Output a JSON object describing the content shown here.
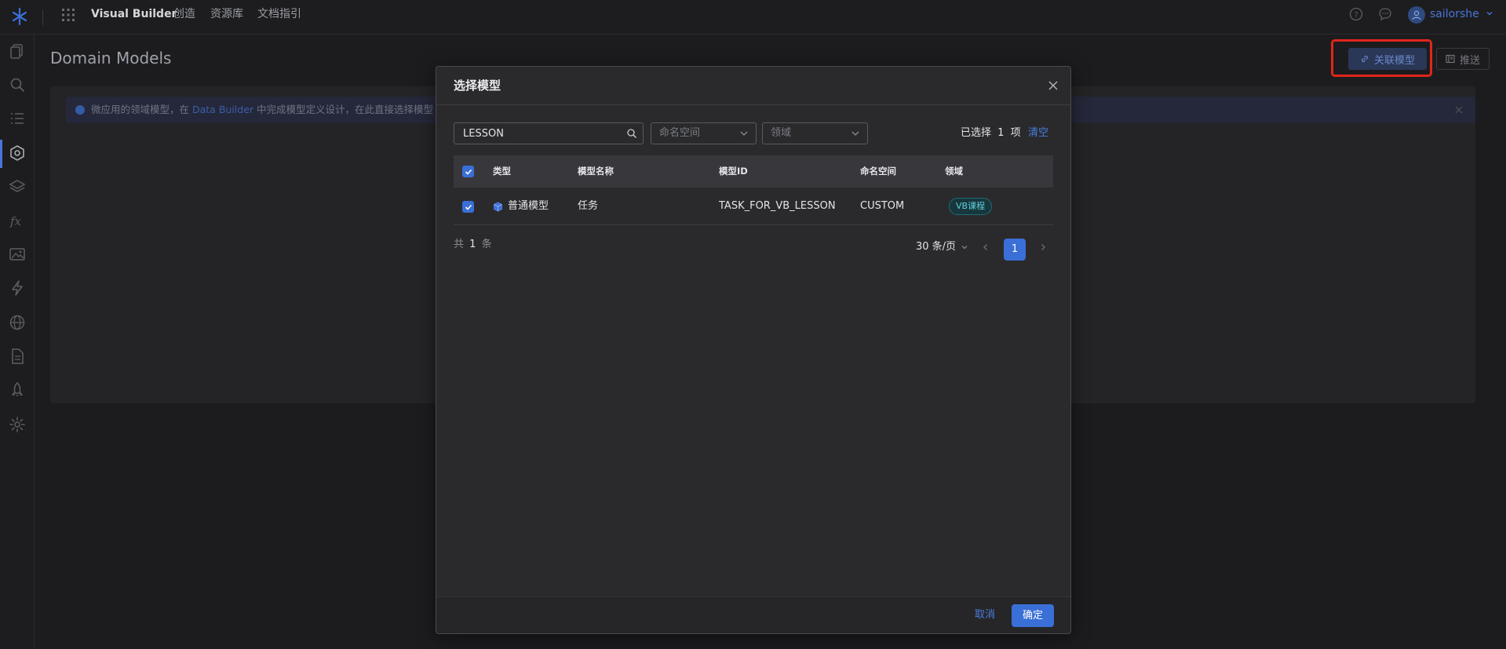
{
  "topbar": {
    "brand": "Visual Builder",
    "nav_items": [
      "创造",
      "资源库",
      "文档指引"
    ],
    "user_name": "sailorshe",
    "icons": [
      "logo-icon",
      "app-grid-icon",
      "help-icon",
      "message-icon",
      "user-avatar-icon",
      "chevron-down-icon"
    ]
  },
  "sidebar": {
    "icons": [
      "pages-icon",
      "search-icon",
      "list-icon",
      "domain-model-icon",
      "layers-icon",
      "function-icon",
      "image-icon",
      "lightning-icon",
      "globe-icon",
      "document-icon",
      "rocket-icon",
      "settings-icon"
    ],
    "active_index": 3
  },
  "page": {
    "title": "Domain Models",
    "link_model_button": "关联模型",
    "push_button": "推送",
    "info_text_prefix": "微应用的领域模型，在",
    "info_link": "Data Builder",
    "info_text_suffix": "中完成模型定义设计，在此直接选择模型"
  },
  "modal": {
    "title": "选择模型",
    "search_value": "LESSON",
    "namespace_placeholder": "命名空间",
    "domain_placeholder": "领域",
    "selected_prefix": "已选择",
    "selected_count": "1",
    "selected_suffix": "项",
    "clear_label": "清空",
    "columns": [
      "类型",
      "模型名称",
      "模型ID",
      "命名空间",
      "领域"
    ],
    "rows": [
      {
        "checked": true,
        "type": "普通模型",
        "name": "任务",
        "id": "TASK_FOR_VB_LESSON",
        "namespace": "CUSTOM",
        "domain": "VB课程"
      }
    ],
    "total_prefix": "共",
    "total_count": "1",
    "total_suffix": "条",
    "page_size": "30 条/页",
    "current_page": "1",
    "cancel_label": "取消",
    "ok_label": "确定"
  },
  "colors": {
    "accent": "#3a6fd8",
    "highlight": "#e0261b",
    "background": "#1c1c1e"
  }
}
